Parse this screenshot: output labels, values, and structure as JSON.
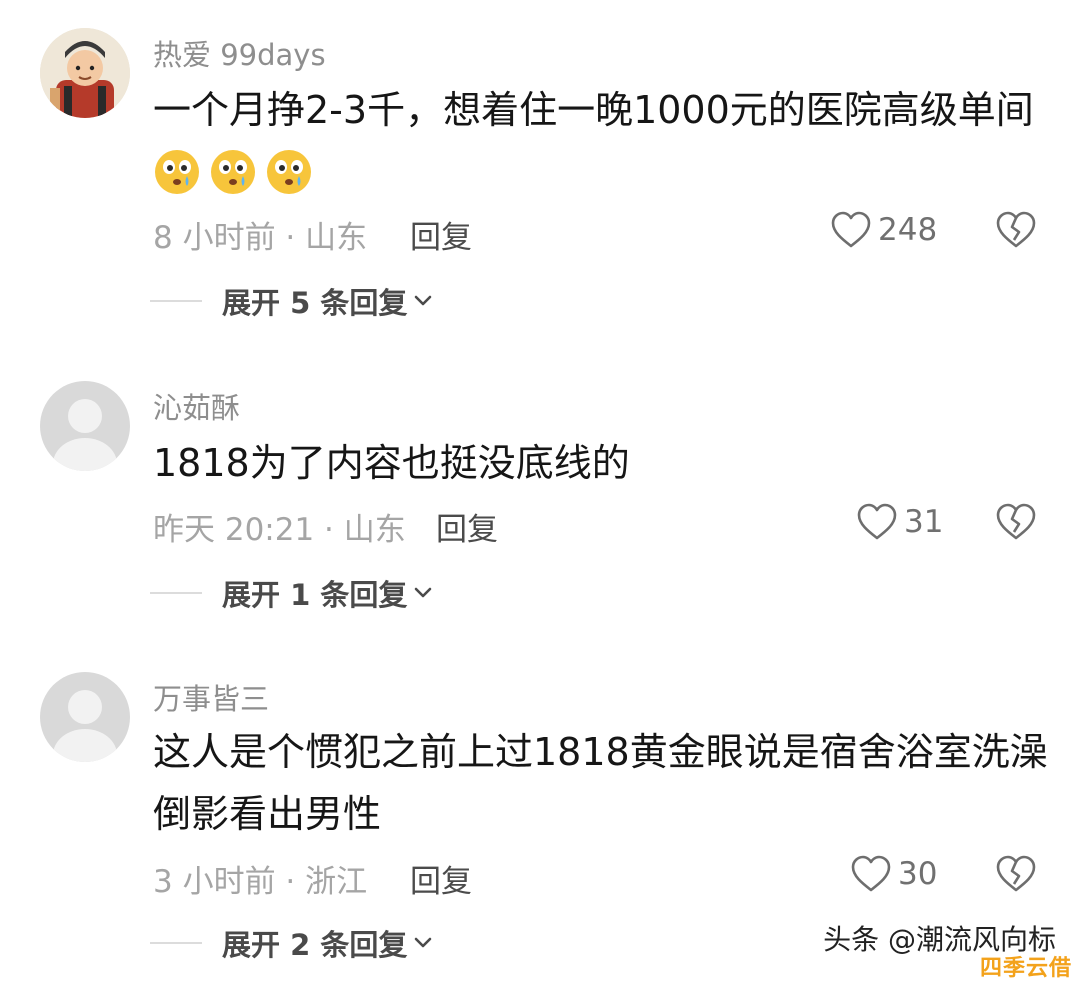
{
  "comments": [
    {
      "username": "热爱 99days",
      "text_lines": [
        "一个月挣2-3千，想着住一晚1000元的医院高级单间"
      ],
      "emoji_count": 3,
      "meta": "8 小时前 · 山东",
      "reply_label": "回复",
      "likes": "248",
      "expand_label": "展开 5 条回复"
    },
    {
      "username": "沁茹酥",
      "text_lines": [
        "1818为了内容也挺没底线的"
      ],
      "meta": "昨天 20:21 · 山东",
      "reply_label": "回复",
      "likes": "31",
      "expand_label": "展开 1 条回复"
    },
    {
      "username": "万事皆三",
      "text_lines": [
        "这人是个惯犯之前上过1818黄金眼说是宿舍浴室洗澡",
        "倒影看出男性"
      ],
      "meta": "3 小时前 · 浙江",
      "reply_label": "回复",
      "likes": "30",
      "expand_label": "展开 2 条回复"
    }
  ],
  "watermark": {
    "text": "头条 @潮流风向标",
    "logo": "四季云借"
  },
  "icons": {
    "like": "heart-outline-icon",
    "dislike": "broken-heart-icon",
    "expand": "chevron-down-icon",
    "emoji": "crying-face-emoji"
  },
  "colors": {
    "username": "#8e8e8e",
    "meta": "#a5a5a5",
    "text": "#161616",
    "emoji_yellow": "#f7c53b"
  }
}
